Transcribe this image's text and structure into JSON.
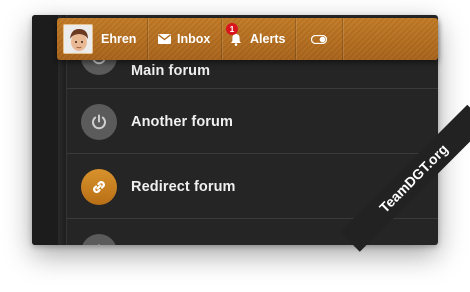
{
  "colors": {
    "accent": "#b86f16",
    "badge": "#d8141e",
    "panel": "#252525"
  },
  "nav": {
    "user_name": "Ehren",
    "inbox_label": "Inbox",
    "alerts_label": "Alerts",
    "alerts_badge": "1",
    "avatar_icon": "user-avatar",
    "inbox_icon": "envelope-icon",
    "alerts_icon": "bell-icon",
    "toggle_icon": "toggle-icon"
  },
  "forums": [
    {
      "title": "Main forum",
      "icon": "power-icon"
    },
    {
      "title": "Another forum",
      "icon": "power-icon"
    },
    {
      "title": "Redirect forum",
      "icon": "link-icon"
    },
    {
      "title": "",
      "icon": "power-icon"
    }
  ],
  "watermark": "TeamDGT.org"
}
